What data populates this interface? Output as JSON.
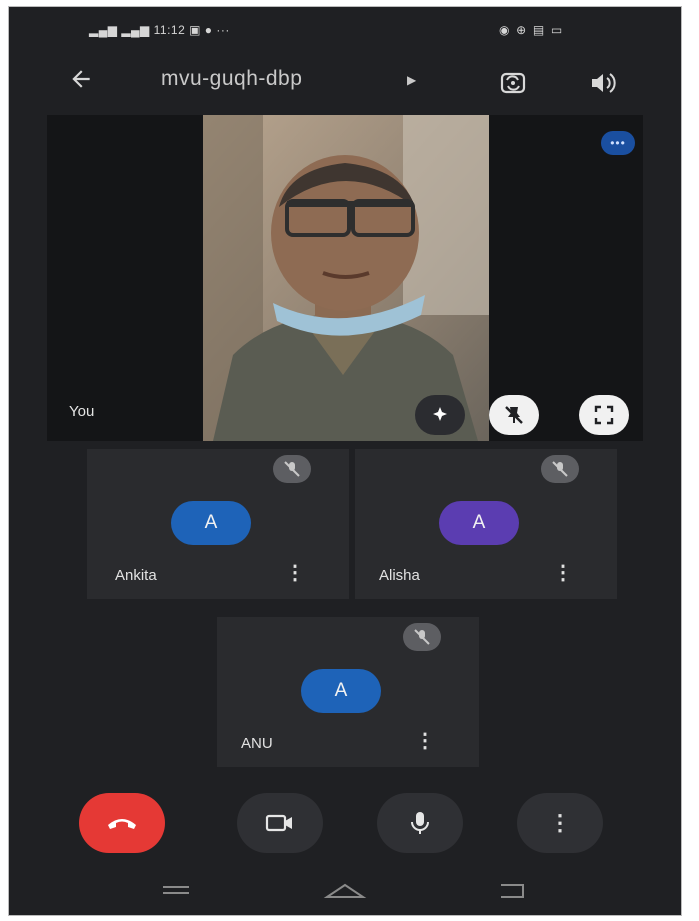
{
  "status_bar": {
    "left_text": "Ꞵ᷊ᵢₗ ᵀᵢₗ 11:12 ▣ ● ···",
    "time": "11:12",
    "right_icons": [
      "data-icon",
      "wifi-icon",
      "nfc-icon",
      "battery-icon"
    ]
  },
  "header": {
    "meeting_code": "mvu-guqh-dbp",
    "back_icon": "arrow-left-icon",
    "switch_camera_icon": "switch-camera-icon",
    "speaker_icon": "speaker-icon"
  },
  "self_tile": {
    "label": "You",
    "more_badge": "•••"
  },
  "participants": [
    {
      "name": "Ankita",
      "initial": "A",
      "color": "#1e63b8",
      "muted": true
    },
    {
      "name": "Alisha",
      "initial": "A",
      "color": "#5b3db1",
      "muted": true
    },
    {
      "name": "ANU",
      "initial": "A",
      "color": "#1e63b8",
      "muted": true
    }
  ],
  "controls": {
    "end_call": "end-call-icon",
    "camera": "camera-icon",
    "microphone": "mic-icon",
    "more": "more-vert-icon"
  },
  "colors": {
    "background": "#1f2023",
    "tile": "#2a2b2e",
    "end_call": "#e53935",
    "accent": "#1a4fa0"
  }
}
